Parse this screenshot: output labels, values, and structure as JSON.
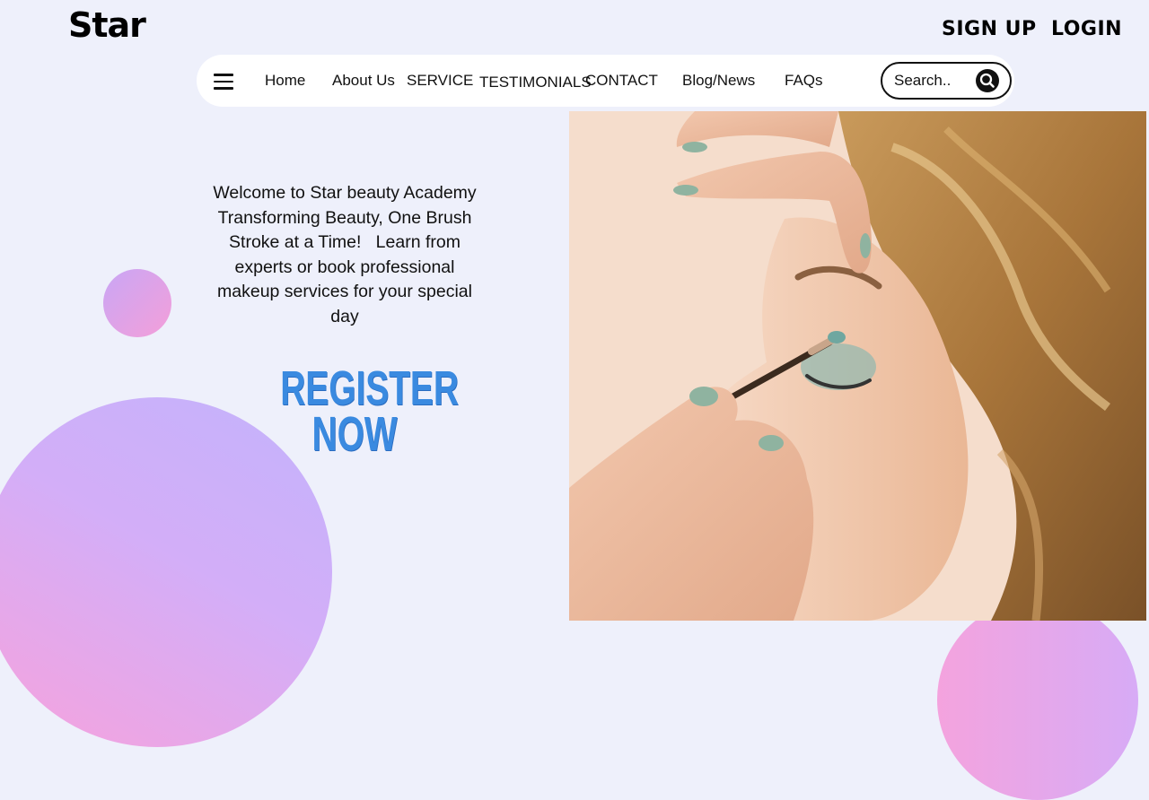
{
  "brand": {
    "logo": "Star"
  },
  "auth": {
    "signup": "SIGN UP",
    "login": "LOGIN"
  },
  "nav": {
    "menu_icon": "hamburger-menu-icon",
    "links": [
      "Home",
      "About Us",
      "SERVICE",
      "TESTIMONIALS",
      "CONTACT",
      "Blog/News",
      "FAQs"
    ],
    "search": {
      "placeholder": "Search..",
      "icon": "search-icon"
    }
  },
  "hero": {
    "welcome_lines": [
      "Welcome to Star beauty Academy",
      "Transforming Beauty, One Brush",
      "Stroke at a Time!   Learn from",
      "experts or book professional",
      "makeup services for your special",
      "day"
    ],
    "cta_lines": [
      "REGISTER",
      "NOW"
    ],
    "image": "makeup-application-photo"
  },
  "colors": {
    "background": "#eef0fb",
    "cta": "#3a8ae0",
    "blob_pink": "#f4a3de",
    "blob_purple": "#c9a6f5"
  }
}
